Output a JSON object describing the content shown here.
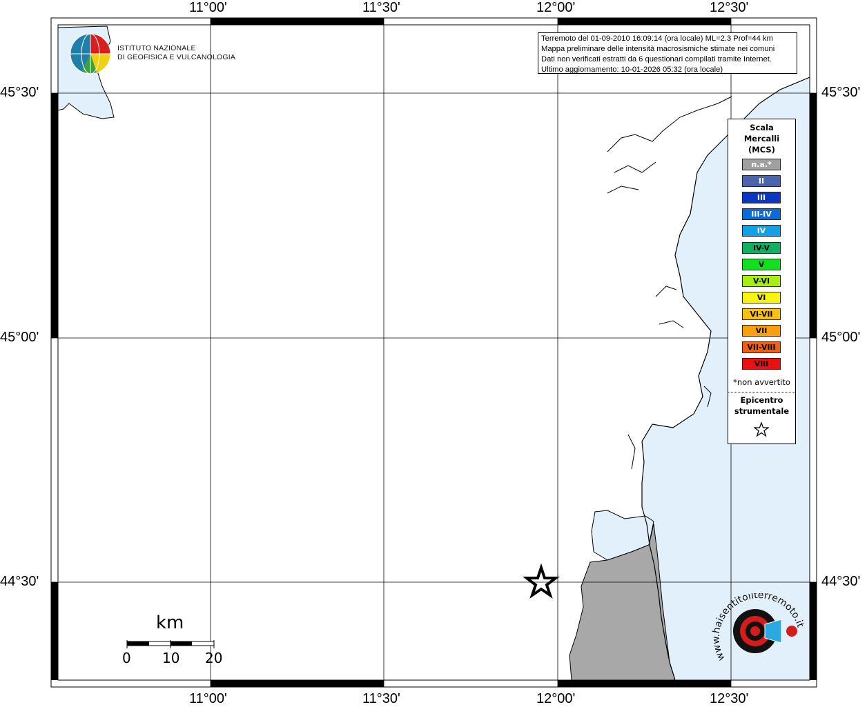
{
  "info_box": {
    "line1": "Terremoto del 01-09-2010 16:09:14 (ora locale) ML=2.3 Prof=44 km",
    "line2": "Mappa preliminare delle intensità macrosismiche stimate nei comuni",
    "line3": "Dati non verificati estratti da 6 questionari compilati tramite Internet.",
    "line4": "Ultimo aggiornamento: 10-01-2026 05:32 (ora locale)"
  },
  "axes": {
    "top_labels": [
      "11°00'",
      "11°30'",
      "12°00'",
      "12°30'"
    ],
    "bottom_labels": [
      "11°00'",
      "11°30'",
      "12°00'",
      "12°30'"
    ],
    "left_labels": [
      "45°30'",
      "45°00'",
      "44°30'"
    ],
    "right_labels": [
      "45°30'",
      "45°00'",
      "44°30'"
    ]
  },
  "logo": {
    "name_line1": "ISTITUTO NAZIONALE",
    "name_line2": "DI GEOFISICA E VULCANOLOGIA"
  },
  "legend": {
    "title_line1": "Scala",
    "title_line2": "Mercalli",
    "title_line3": "(MCS)",
    "items": [
      {
        "label": "n.a.*",
        "color": "#a0a0a0",
        "text_color": "#ffffff"
      },
      {
        "label": "II",
        "color": "#4a64ae",
        "text_color": "#ffffff"
      },
      {
        "label": "III",
        "color": "#0a37c2",
        "text_color": "#ffffff"
      },
      {
        "label": "III-IV",
        "color": "#0a6ad8",
        "text_color": "#ffffff"
      },
      {
        "label": "IV",
        "color": "#12a0e8",
        "text_color": "#ffffff"
      },
      {
        "label": "IV-V",
        "color": "#10b060",
        "text_color": "#000000"
      },
      {
        "label": "V",
        "color": "#10e020",
        "text_color": "#000000"
      },
      {
        "label": "V-VI",
        "color": "#a8ee10",
        "text_color": "#000000"
      },
      {
        "label": "VI",
        "color": "#f6f410",
        "text_color": "#000000"
      },
      {
        "label": "VI-VII",
        "color": "#f8c010",
        "text_color": "#000000"
      },
      {
        "label": "VII",
        "color": "#f8a010",
        "text_color": "#000000"
      },
      {
        "label": "VII-VIII",
        "color": "#f06010",
        "text_color": "#000000"
      },
      {
        "label": "VIII",
        "color": "#e81010",
        "text_color": "#000000"
      }
    ],
    "note": "*non avvertito",
    "epicentre_line1": "Epicentro",
    "epicentre_line2": "strumentale"
  },
  "scalebar": {
    "unit": "km",
    "labels": [
      "0",
      "10",
      "20"
    ]
  },
  "brand_logo": {
    "text": "www.haisentitoilterremoto.it"
  },
  "colors": {
    "sea": "#e2f0fb",
    "not_felt": "#a8a8a8",
    "coast": "#000000"
  }
}
